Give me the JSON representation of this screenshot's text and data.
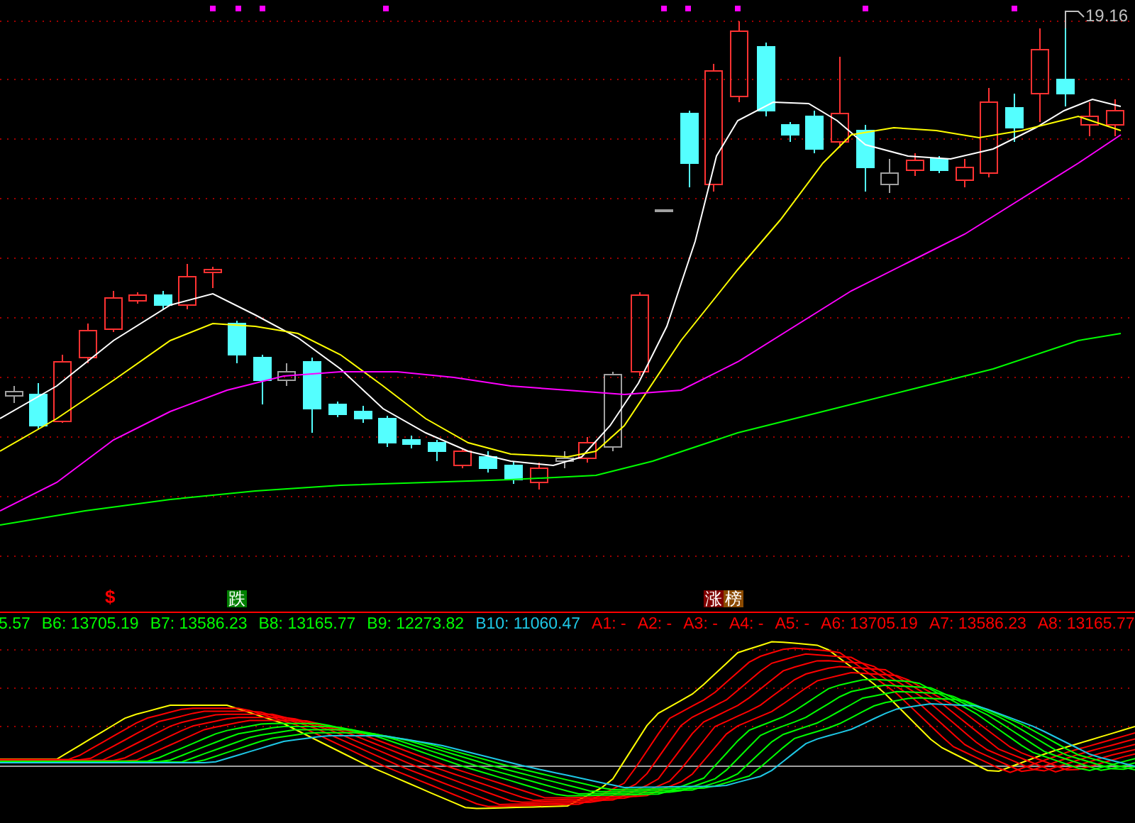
{
  "price_label": {
    "text": "19.16"
  },
  "markers": [
    {
      "kind": "text",
      "text": "$",
      "color": "#ff0000"
    },
    {
      "kind": "badge",
      "text": "跌",
      "color": "#008000"
    },
    {
      "kind": "badge",
      "text": "涨",
      "color": "#800000"
    },
    {
      "kind": "badge",
      "text": "榜",
      "color": "#8b4a00"
    }
  ],
  "legend": [
    {
      "text": "5.57",
      "color": "#00ff00"
    },
    {
      "text": "B6: 13705.19",
      "color": "#00ff00"
    },
    {
      "text": "B7: 13586.23",
      "color": "#00ff00"
    },
    {
      "text": "B8: 13165.77",
      "color": "#00ff00"
    },
    {
      "text": "B9: 12273.82",
      "color": "#00ff00"
    },
    {
      "text": "B10: 11060.47",
      "color": "#1ec8e6"
    },
    {
      "text": "A1: -",
      "color": "#ff0000"
    },
    {
      "text": "A2: -",
      "color": "#ff0000"
    },
    {
      "text": "A3: -",
      "color": "#ff0000"
    },
    {
      "text": "A4: -",
      "color": "#ff0000"
    },
    {
      "text": "A5: -",
      "color": "#ff0000"
    },
    {
      "text": "A6: 13705.19",
      "color": "#ff0000"
    },
    {
      "text": "A7: 13586.23",
      "color": "#ff0000"
    },
    {
      "text": "A8: 13165.77",
      "color": "#ff0000"
    }
  ]
}
